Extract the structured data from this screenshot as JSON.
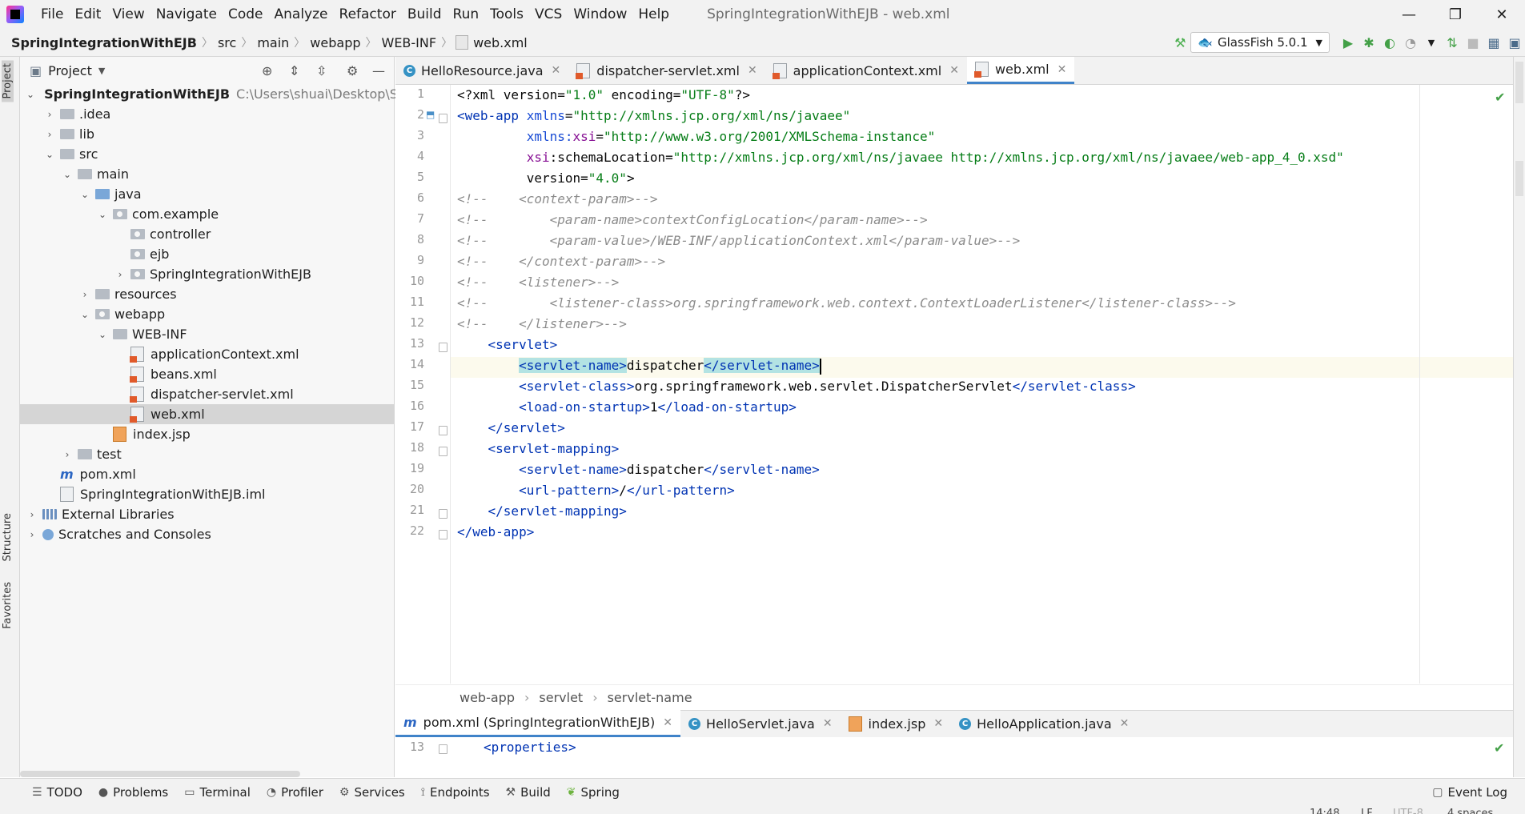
{
  "window": {
    "title": "SpringIntegrationWithEJB - web.xml",
    "menu": [
      "File",
      "Edit",
      "View",
      "Navigate",
      "Code",
      "Analyze",
      "Refactor",
      "Build",
      "Run",
      "Tools",
      "VCS",
      "Window",
      "Help"
    ],
    "controls": {
      "minimize": "—",
      "restore": "❐",
      "close": "✕"
    }
  },
  "navbar": {
    "breadcrumbs": [
      "SpringIntegrationWithEJB",
      "src",
      "main",
      "webapp",
      "WEB-INF",
      "web.xml"
    ],
    "run_config": "GlassFish 5.0.1"
  },
  "left_stripe": {
    "project": "Project",
    "structure": "Structure",
    "favorites": "Favorites"
  },
  "project_panel": {
    "title": "Project",
    "tree": [
      {
        "label": "SpringIntegrationWithEJB",
        "path": "C:\\Users\\shuai\\Desktop\\Sprir",
        "kind": "module",
        "level": 0,
        "expanded": true
      },
      {
        "label": ".idea",
        "kind": "folder",
        "level": 1,
        "expanded": false
      },
      {
        "label": "lib",
        "kind": "folder",
        "level": 1,
        "expanded": false
      },
      {
        "label": "src",
        "kind": "folder",
        "level": 1,
        "expanded": true
      },
      {
        "label": "main",
        "kind": "folder",
        "level": 2,
        "expanded": true
      },
      {
        "label": "java",
        "kind": "source",
        "level": 3,
        "expanded": true
      },
      {
        "label": "com.example",
        "kind": "package",
        "level": 4,
        "expanded": true
      },
      {
        "label": "controller",
        "kind": "package",
        "level": 5
      },
      {
        "label": "ejb",
        "kind": "package",
        "level": 5
      },
      {
        "label": "SpringIntegrationWithEJB",
        "kind": "package",
        "level": 5,
        "expanded": false
      },
      {
        "label": "resources",
        "kind": "resources",
        "level": 3,
        "expanded": false
      },
      {
        "label": "webapp",
        "kind": "web",
        "level": 3,
        "expanded": true
      },
      {
        "label": "WEB-INF",
        "kind": "folder",
        "level": 4,
        "expanded": true
      },
      {
        "label": "applicationContext.xml",
        "kind": "xml",
        "level": 5
      },
      {
        "label": "beans.xml",
        "kind": "xml",
        "level": 5
      },
      {
        "label": "dispatcher-servlet.xml",
        "kind": "xml",
        "level": 5
      },
      {
        "label": "web.xml",
        "kind": "xml",
        "level": 5,
        "selected": true
      },
      {
        "label": "index.jsp",
        "kind": "jsp",
        "level": 4
      },
      {
        "label": "test",
        "kind": "folder",
        "level": 2,
        "expanded": false
      },
      {
        "label": "pom.xml",
        "kind": "maven",
        "level": 1
      },
      {
        "label": "SpringIntegrationWithEJB.iml",
        "kind": "iml",
        "level": 1
      },
      {
        "label": "External Libraries",
        "kind": "libs",
        "level": 0,
        "expanded": false
      },
      {
        "label": "Scratches and Consoles",
        "kind": "scratch",
        "level": 0,
        "expanded": false
      }
    ]
  },
  "editor_tabs": [
    {
      "label": "HelloResource.java",
      "kind": "class"
    },
    {
      "label": "dispatcher-servlet.xml",
      "kind": "xml"
    },
    {
      "label": "applicationContext.xml",
      "kind": "xml"
    },
    {
      "label": "web.xml",
      "kind": "xml",
      "active": true
    }
  ],
  "editor": {
    "line_numbers": [
      "1",
      "2",
      "3",
      "4",
      "5",
      "6",
      "7",
      "8",
      "9",
      "10",
      "11",
      "12",
      "13",
      "14",
      "15",
      "16",
      "17",
      "18",
      "19",
      "20",
      "21",
      "22"
    ],
    "current_line": 14
  },
  "editor_breadcrumbs": [
    "web-app",
    "servlet",
    "servlet-name"
  ],
  "second_tabs": [
    {
      "label": "pom.xml (SpringIntegrationWithEJB)",
      "kind": "maven",
      "active": true
    },
    {
      "label": "HelloServlet.java",
      "kind": "class"
    },
    {
      "label": "index.jsp",
      "kind": "jsp"
    },
    {
      "label": "HelloApplication.java",
      "kind": "class"
    }
  ],
  "second_editor": {
    "line_number": "13",
    "code": "<properties>"
  },
  "tool_windows": [
    "TODO",
    "Problems",
    "Terminal",
    "Profiler",
    "Services",
    "Endpoints",
    "Build",
    "Spring"
  ],
  "event_log": "Event Log",
  "status": {
    "position": "14:48",
    "line_sep": "LF",
    "encoding": "UTF-8",
    "indent": "4 spaces"
  }
}
